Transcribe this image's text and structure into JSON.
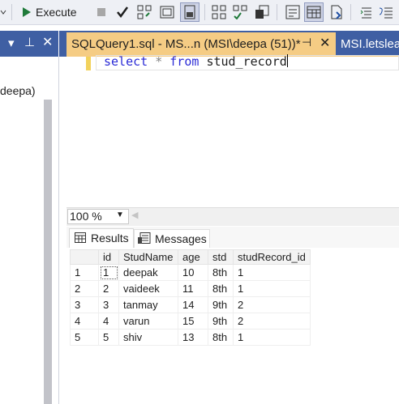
{
  "toolbar": {
    "execute_label": "Execute",
    "icons": [
      "execute-icon",
      "stop-icon",
      "check-icon",
      "parse-icon",
      "display-plan-icon",
      "query-options-icon",
      "include-plan-icon",
      "client-stats-icon",
      "results-text-icon",
      "results-grid-icon",
      "results-file-icon",
      "comment-icon",
      "uncomment-icon"
    ]
  },
  "left_panel": {
    "server_text": "deepa)"
  },
  "tabs": [
    {
      "label": "SQLQuery1.sql - MS...n (MSI\\deepa (51))*",
      "active": true
    },
    {
      "label": "MSI.letslea",
      "active": false
    }
  ],
  "editor": {
    "query": {
      "kw1": "select",
      "op": "*",
      "kw2": "from",
      "table": "stud_record"
    }
  },
  "zoom": {
    "value": "100 %"
  },
  "results_tabs": {
    "results": "Results",
    "messages": "Messages"
  },
  "grid": {
    "columns": [
      "id",
      "StudName",
      "age",
      "std",
      "studRecord_id"
    ],
    "rows": [
      {
        "n": "1",
        "cells": [
          "1",
          "deepak",
          "10",
          "8th",
          "1"
        ]
      },
      {
        "n": "2",
        "cells": [
          "2",
          "vaideek",
          "11",
          "8th",
          "1"
        ]
      },
      {
        "n": "3",
        "cells": [
          "3",
          "tanmay",
          "14",
          "9th",
          "2"
        ]
      },
      {
        "n": "4",
        "cells": [
          "4",
          "varun",
          "15",
          "9th",
          "2"
        ]
      },
      {
        "n": "5",
        "cells": [
          "5",
          "shiv",
          "13",
          "8th",
          "1"
        ]
      }
    ]
  },
  "colors": {
    "tab_bar": "#3f5fa3",
    "active_tab": "#f5cc84",
    "keyword": "#2b2bd6"
  }
}
